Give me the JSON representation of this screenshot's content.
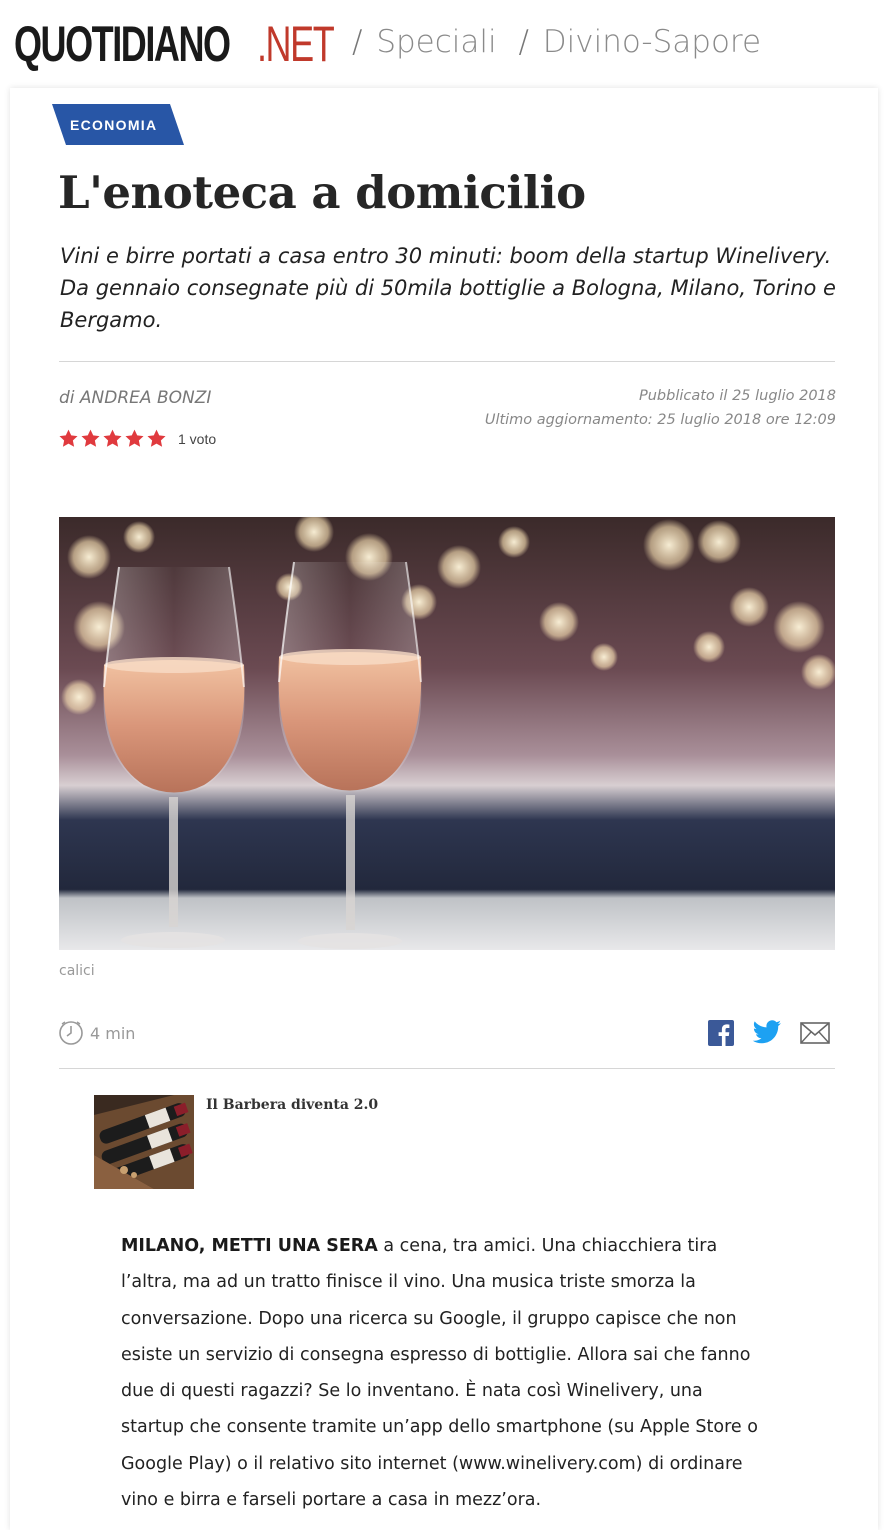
{
  "header": {
    "logo_main": "QUOTIDIANO",
    "logo_ext": ".NET",
    "breadcrumbs": [
      {
        "label": "Speciali"
      },
      {
        "label": "Divino-Sapore"
      }
    ],
    "separator": "/"
  },
  "article": {
    "section": "ECONOMIA",
    "title": "L'enoteca a domicilio",
    "subtitle": "Vini e birre portati a casa entro 30 minuti: boom della startup Winelivery. Da gennaio consegnate più di 50mila bottiglie a Bologna, Milano, Torino e Bergamo.",
    "author": "di ANDREA BONZI",
    "published": "Pubblicato il 25 luglio 2018",
    "updated": "Ultimo aggiornamento: 25 luglio 2018 ore 12:09",
    "rating": {
      "stars": 5,
      "max": 5,
      "votes_label": "1 voto"
    },
    "image_caption": "calici",
    "read_time": "4 min",
    "related": {
      "title": "Il Barbera diventa 2.0"
    },
    "lead": "MILANO, METTI UNA SERA",
    "body": " a cena, tra amici. Una chiacchiera tira l’altra, ma ad un tratto finisce il vino. Una musica triste smorza la conversazione. Dopo una ricerca su Google, il gruppo capisce che non esiste un servizio di consegna espresso di bottiglie. Allora sai che fanno due di questi ragazzi? Se lo inventano. È nata così Winelivery, una startup che consente tramite un’app dello smartphone (su Apple Store o Google Play) o il relativo sito internet (www.winelivery.com) di ordinare vino e birra e farseli portare a casa in mezz’ora."
  },
  "icons": {
    "share": [
      "facebook-icon",
      "twitter-icon",
      "mail-icon"
    ],
    "clock": "clock-icon",
    "star": "star-icon"
  },
  "colors": {
    "section_tag": "#2856a6",
    "logo_accent": "#c0392b",
    "star": "#e03a3e",
    "facebook": "#3b5998",
    "twitter": "#1da1f2"
  }
}
